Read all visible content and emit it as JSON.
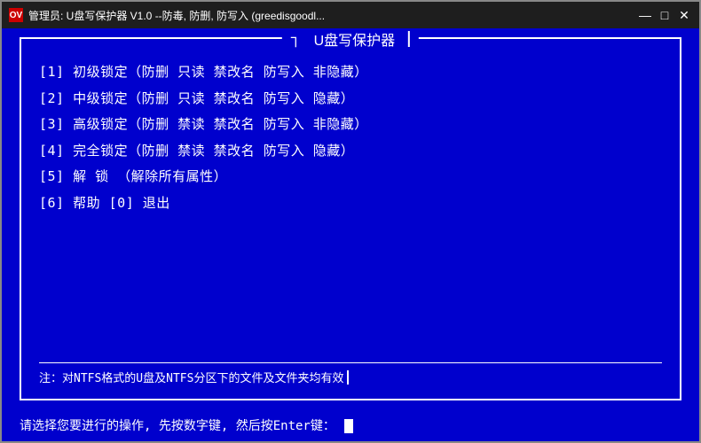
{
  "window": {
    "title": "管理员: U盘写保护器 V1.0  --防毒, 防删, 防写入 (greedisgoodl...",
    "icon_label": "OV"
  },
  "panel": {
    "title": "U盘写保护器",
    "menu_items": [
      "[1] 初级锁定（防删  只读  禁改名  防写入  非隐藏）",
      "[2] 中级锁定（防删  只读  禁改名  防写入  隐藏）",
      "[3] 高级锁定（防删  禁读  禁改名  防写入  非隐藏）",
      "[4] 完全锁定（防删  禁读  禁改名  防写入  隐藏）",
      "[5] 解  锁    （解除所有属性）",
      "[6] 帮助       [0] 退出"
    ],
    "note": "注：对NTFS格式的U盘及NTFS分区下的文件及文件夹均有效"
  },
  "bottom_bar": {
    "prompt": "请选择您要进行的操作, 先按数字键, 然后按Enter键："
  },
  "title_buttons": {
    "minimize": "—",
    "maximize": "□",
    "close": "✕"
  }
}
